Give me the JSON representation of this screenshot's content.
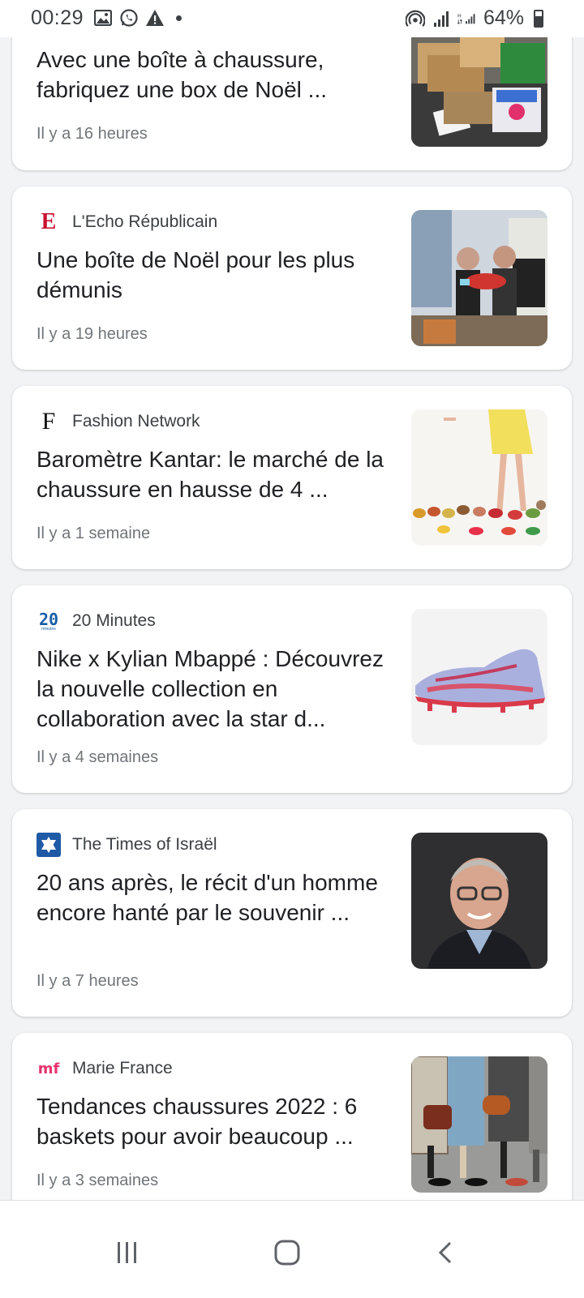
{
  "status_bar": {
    "time": "00:29",
    "icons_left": [
      "gallery-icon",
      "whatsapp-icon",
      "warning-icon",
      "dot-icon"
    ],
    "icons_right": [
      "hotspot-icon",
      "signal-icon",
      "data-signal-icon"
    ],
    "battery": "64%"
  },
  "feed": [
    {
      "source": "",
      "title": "Avec une boîte à chaussure, fabriquez une box de Noël ...",
      "time": "Il y a 16 heures",
      "image": "christmas-boxes-photo"
    },
    {
      "source": "L'Echo Républicain",
      "logo_letter": "E",
      "title": "Une boîte de Noël pour les plus démunis",
      "time": "Il y a 19 heures",
      "image": "volunteers-gift-box-photo"
    },
    {
      "source": "Fashion Network",
      "logo_letter": "F",
      "title": "Baromètre Kantar: le marché de la chaussure en hausse de 4 ...",
      "time": "Il y a 1 semaine",
      "image": "shoes-display-photo"
    },
    {
      "source": "20 Minutes",
      "logo_letter": "20",
      "logo_sub": "minutes",
      "title": "Nike x Kylian Mbappé : Découvrez la nouvelle collection en collaboration avec la star d...",
      "time": "Il y a 4 semaines",
      "image": "football-boot-photo"
    },
    {
      "source": "The Times of Israël",
      "title": "20 ans après, le récit d'un homme encore hanté par le souvenir ...",
      "time": "Il y a 7 heures",
      "image": "man-portrait-photo"
    },
    {
      "source": "Marie France",
      "logo_letter": "mf",
      "title": "Tendances chaussures 2022 : 6 baskets pour avoir beaucoup ...",
      "time": "Il y a 3 semaines",
      "image": "street-fashion-photo"
    }
  ],
  "nav": {
    "buttons": [
      "recent-apps-icon",
      "home-icon",
      "back-icon"
    ]
  },
  "colors": {
    "background": "#f1f3f4",
    "card": "#ffffff",
    "echo_red": "#c8102e",
    "minutes_blue": "#1a5fa8",
    "times_blue": "#1f5aa6",
    "mf_pink": "#e8336e"
  }
}
